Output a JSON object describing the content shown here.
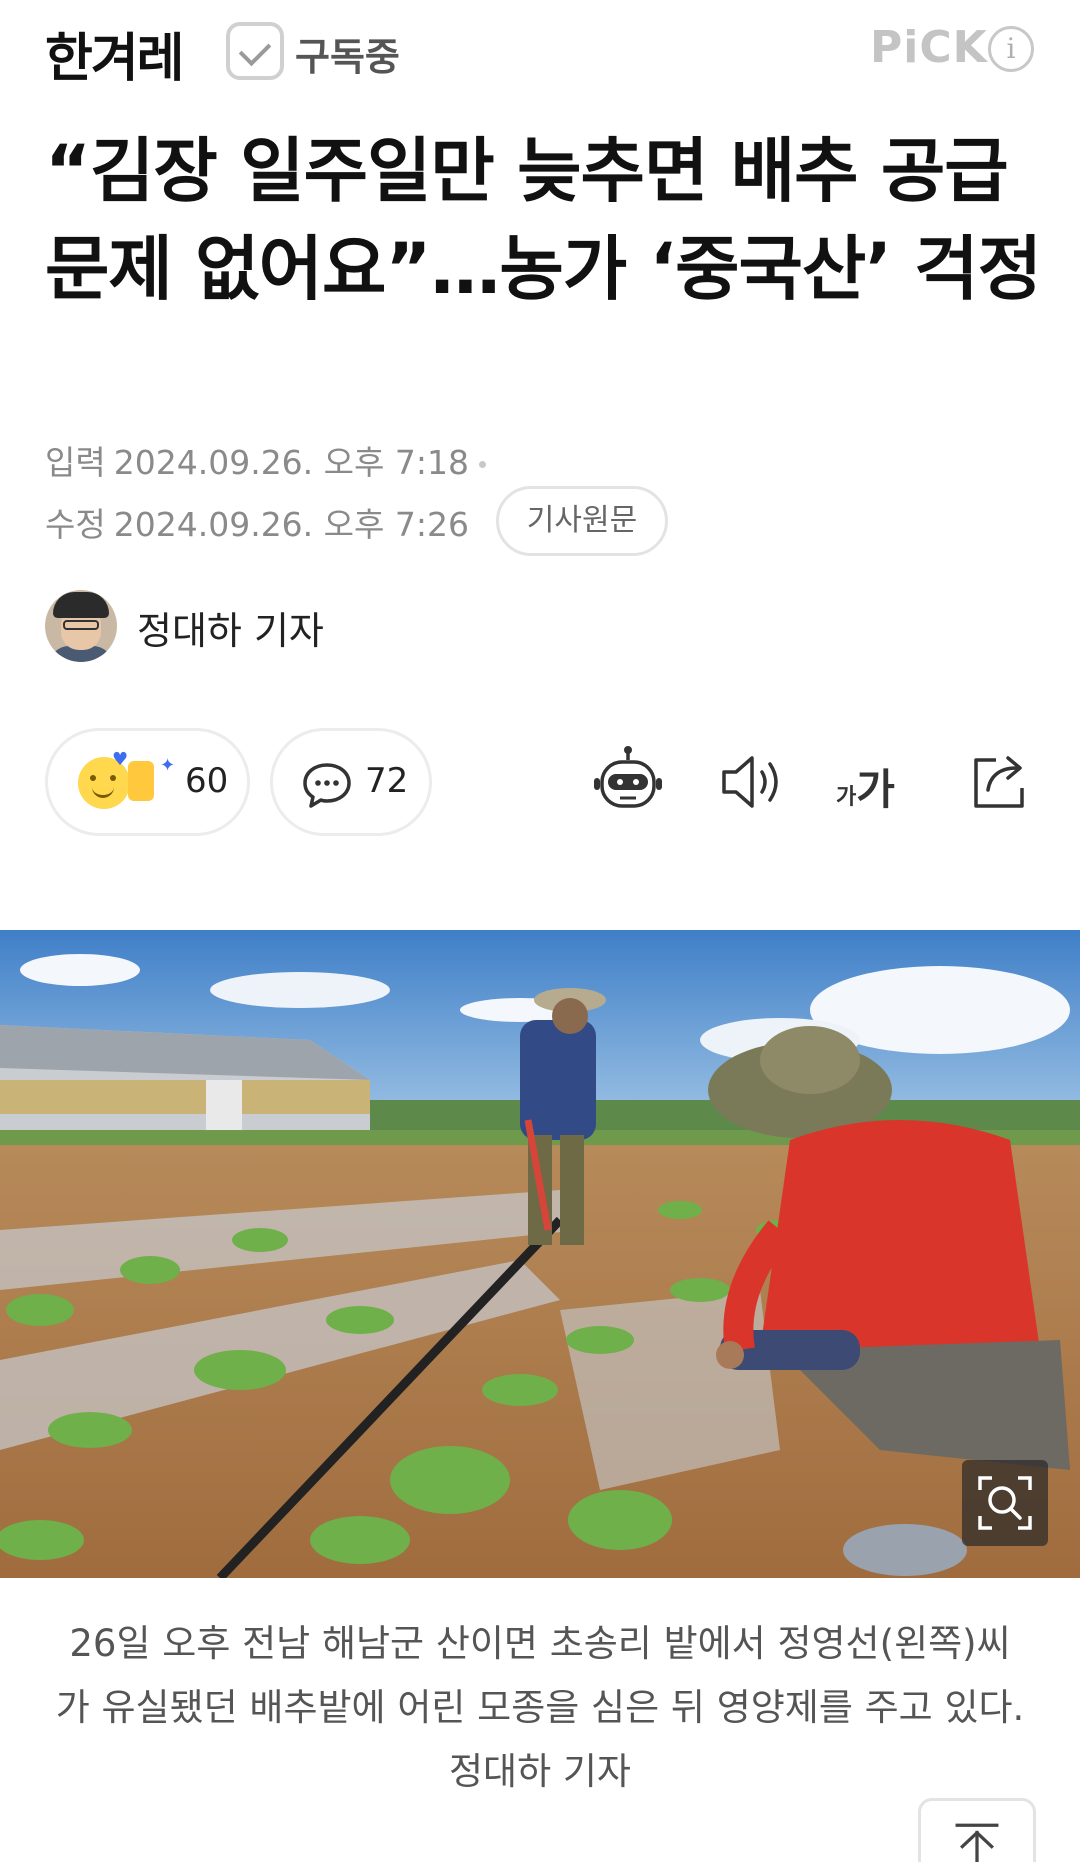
{
  "header": {
    "logo": "한겨레",
    "subscribe_label": "구독중",
    "pick_label": "PiCK",
    "info_label": "i"
  },
  "article": {
    "title": "“김장 일주일만 늦추면 배추 공급 문제 없어요”…농가 ‘중국산’ 걱정",
    "published_label": "입력",
    "published": "2024.09.26. 오후 7:18",
    "modified_label": "수정",
    "modified": "2024.09.26. 오후 7:26",
    "origin_button": "기사원문",
    "author": "정대하 기자"
  },
  "actions": {
    "reaction_count": "60",
    "comment_count": "72",
    "font_small": "가",
    "font_big": "가"
  },
  "icons": {
    "robot": "robot-icon",
    "speaker": "speaker-icon",
    "share": "share-icon",
    "zoom": "zoom-search-icon",
    "scroll_top": "arrow-up-icon"
  },
  "photo": {
    "caption": "26일 오후 전남 해남군 산이면 초송리 밭에서 정영선(왼쪽)씨가 유실됐던 배추밭에 어린 모종을 심은 뒤 영양제를 주고 있다. 정대하 기자"
  },
  "colors": {
    "accent_blue": "#3e6ef0",
    "reaction_yellow": "#ffd84d",
    "meta_gray": "#8a8a8a"
  }
}
